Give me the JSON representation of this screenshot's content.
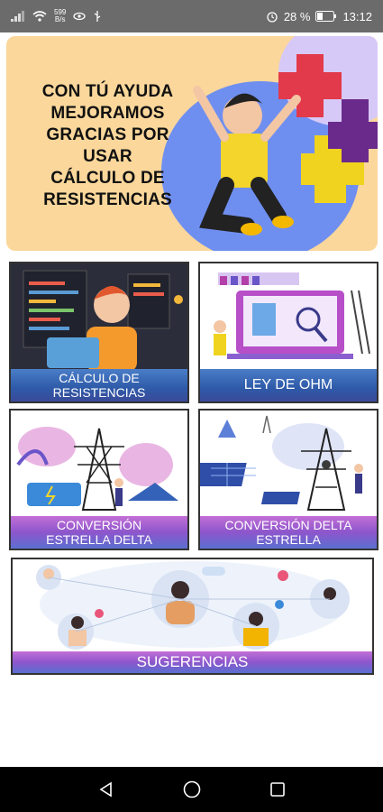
{
  "status_bar": {
    "net_speed_value": "599",
    "net_speed_unit": "B/s",
    "battery": "28 %",
    "time": "13:12"
  },
  "banner": {
    "lines": [
      "CON TÚ AYUDA",
      "MEJORAMOS",
      "GRACIAS POR",
      "USAR",
      "CÁLCULO DE",
      "RESISTENCIAS"
    ],
    "slides": 3,
    "active_slide": 3
  },
  "cards": {
    "calculo": {
      "label_line1": "CÁLCULO DE",
      "label_line2": "RESISTENCIAS"
    },
    "ohm": {
      "label": "LEY DE OHM"
    },
    "estrella_delta": {
      "label_line1": "CONVERSIÓN",
      "label_line2": "ESTRELLA DELTA"
    },
    "delta_estrella": {
      "label_line1": "CONVERSIÓN DELTA",
      "label_line2": "ESTRELLA"
    },
    "sugerencias": {
      "label": "SUGERENCIAS"
    }
  },
  "colors": {
    "banner_bg": "#fbd79b",
    "label_blue": "#2e5aa8",
    "label_purple": "#8d56cc",
    "status_bar": "#6b6b6b"
  }
}
